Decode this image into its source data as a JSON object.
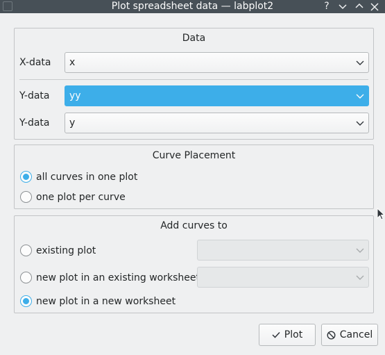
{
  "window": {
    "title": "Plot spreadsheet data — labplot2",
    "help_icon": "question-mark-icon",
    "minimize_icon": "chevron-down-icon",
    "maximize_icon": "chevron-up-icon",
    "close_icon": "close-icon"
  },
  "data_group": {
    "title": "Data",
    "rows": [
      {
        "label": "X-data",
        "value": "x"
      },
      {
        "label": "Y-data",
        "value": "yy"
      },
      {
        "label": "Y-data",
        "value": "y"
      }
    ]
  },
  "placement_group": {
    "title": "Curve Placement",
    "options": [
      {
        "label": "all curves in one plot",
        "checked": true
      },
      {
        "label": "one plot per curve",
        "checked": false
      }
    ]
  },
  "add_group": {
    "title": "Add curves to",
    "options": [
      {
        "label": "existing plot",
        "checked": false
      },
      {
        "label": "new plot in an existing worksheet",
        "checked": false
      },
      {
        "label": "new plot in a new worksheet",
        "checked": true
      }
    ]
  },
  "buttons": {
    "plot": "Plot",
    "cancel": "Cancel"
  },
  "colors": {
    "accent": "#3daee9",
    "titlebar": "#475057",
    "background": "#eff0f1"
  }
}
